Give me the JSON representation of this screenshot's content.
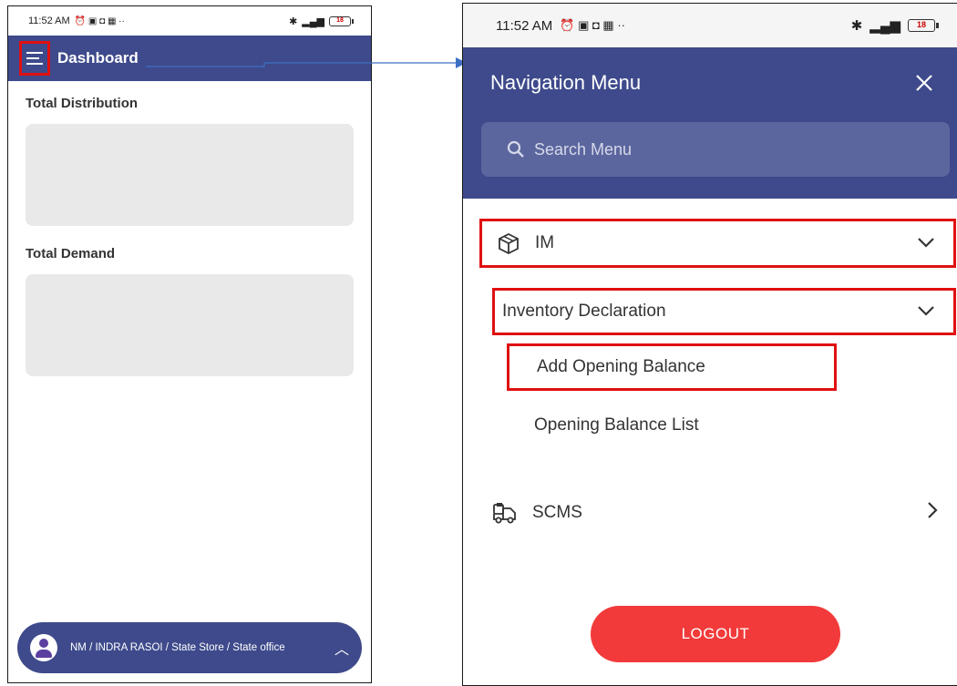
{
  "left_screen": {
    "status_bar": {
      "time": "11:52 AM",
      "left_icons": "⏰ ▣ ◘ ▦ ··",
      "battery": "18"
    },
    "app_bar": {
      "title": "Dashboard"
    },
    "sections": [
      {
        "title": "Total Distribution"
      },
      {
        "title": "Total Demand"
      }
    ],
    "user_pill": {
      "text": "NM / INDRA RASOI / State Store / State office"
    }
  },
  "right_screen": {
    "status_bar": {
      "time": "11:52 AM",
      "left_icons": "⏰ ▣ ◘ ▦ ··",
      "battery": "18"
    },
    "nav_title": "Navigation Menu",
    "search": {
      "placeholder": "Search Menu"
    },
    "menu": {
      "im": {
        "label": "IM",
        "icon": "box-icon"
      },
      "inventory_declaration": {
        "label": "Inventory Declaration"
      },
      "add_opening_balance": {
        "label": "Add Opening Balance"
      },
      "opening_balance_list": {
        "label": "Opening Balance List"
      },
      "scms": {
        "label": "SCMS",
        "icon": "truck-icon"
      }
    },
    "logout": {
      "label": "LOGOUT"
    }
  },
  "colors": {
    "primary": "#3e4a8b",
    "highlight": "#e01010",
    "logout": "#f23a3a",
    "card": "#e9e9e9"
  }
}
